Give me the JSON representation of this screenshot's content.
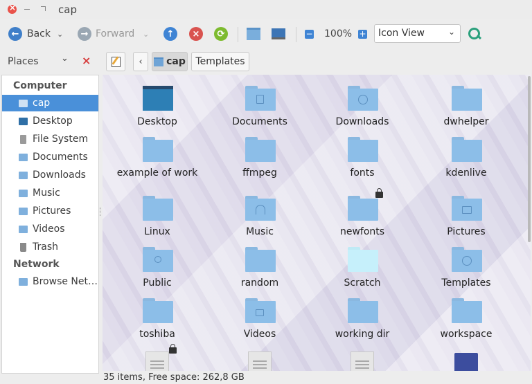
{
  "window": {
    "title": "cap"
  },
  "toolbar": {
    "back_label": "Back",
    "forward_label": "Forward",
    "zoom": "100%",
    "view_mode": "Icon View"
  },
  "places_header": {
    "label": "Places"
  },
  "pathbar": {
    "crumbs": [
      "cap",
      "Templates"
    ]
  },
  "sidebar": {
    "categories": [
      "Computer",
      "Network"
    ],
    "items": [
      {
        "label": "cap",
        "icon": "home-folder-icon",
        "selected": true
      },
      {
        "label": "Desktop",
        "icon": "desktop-icon"
      },
      {
        "label": "File System",
        "icon": "drive-icon"
      },
      {
        "label": "Documents",
        "icon": "folder-icon"
      },
      {
        "label": "Downloads",
        "icon": "folder-icon"
      },
      {
        "label": "Music",
        "icon": "folder-icon"
      },
      {
        "label": "Pictures",
        "icon": "folder-icon"
      },
      {
        "label": "Videos",
        "icon": "folder-icon"
      },
      {
        "label": "Trash",
        "icon": "trash-icon"
      },
      {
        "label": "Browse Net…",
        "icon": "network-icon"
      }
    ]
  },
  "files": [
    {
      "name": "Desktop",
      "icon": "desktop-folder-icon"
    },
    {
      "name": "Documents",
      "icon": "documents-folder-icon"
    },
    {
      "name": "Downloads",
      "icon": "downloads-folder-icon"
    },
    {
      "name": "dwhelper",
      "icon": "folder-icon"
    },
    {
      "name": "example of work",
      "icon": "folder-icon"
    },
    {
      "name": "ffmpeg",
      "icon": "folder-icon"
    },
    {
      "name": "fonts",
      "icon": "folder-icon"
    },
    {
      "name": "kdenlive",
      "icon": "folder-icon"
    },
    {
      "name": "Linux",
      "icon": "folder-icon"
    },
    {
      "name": "Music",
      "icon": "music-folder-icon"
    },
    {
      "name": "newfonts",
      "icon": "locked-folder-icon"
    },
    {
      "name": "Pictures",
      "icon": "pictures-folder-icon"
    },
    {
      "name": "Public",
      "icon": "public-folder-icon"
    },
    {
      "name": "random",
      "icon": "folder-icon"
    },
    {
      "name": "Scratch",
      "icon": "scratch-folder-icon"
    },
    {
      "name": "Templates",
      "icon": "templates-folder-icon"
    },
    {
      "name": "toshiba",
      "icon": "folder-icon"
    },
    {
      "name": "Videos",
      "icon": "videos-folder-icon"
    },
    {
      "name": "working dir",
      "icon": "folder-icon"
    },
    {
      "name": "workspace",
      "icon": "folder-icon"
    }
  ],
  "statusbar": {
    "text": "35 items, Free space: 262,8 GB"
  }
}
